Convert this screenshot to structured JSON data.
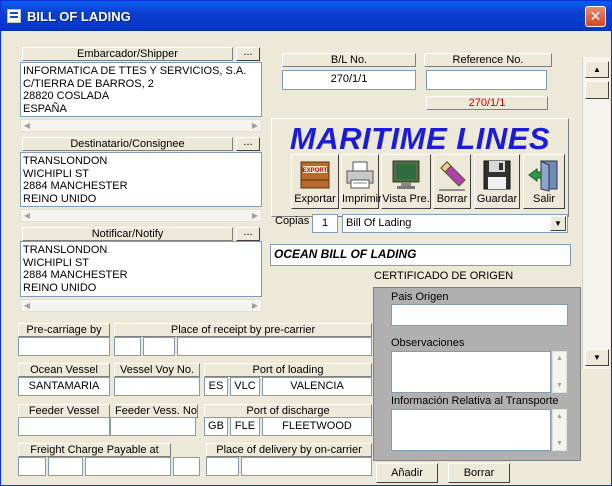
{
  "window": {
    "title": "BILL OF LADING"
  },
  "shipper": {
    "header": "Embarcador/Shipper",
    "lines": "INFORMATICA DE TTES Y SERVICIOS, S.A.\nC/TIERRA DE BARROS, 2\n28820 COSLADA\nESPAÑA"
  },
  "consignee": {
    "header": "Destinatario/Consignee",
    "lines": "TRANSLONDON\nWICHIPLI ST\n2884 MANCHESTER\nREINO UNIDO"
  },
  "notify": {
    "header": "Notificar/Notify",
    "lines": "TRANSLONDON\nWICHIPLI ST\n2884 MANCHESTER\nREINO UNIDO"
  },
  "dots_label": "...",
  "bl": {
    "label": "B/L No.",
    "value": "270/1/1"
  },
  "reference": {
    "label": "Reference No.",
    "value": "",
    "sub_value": "270/1/1",
    "sub_color": "#CC0000"
  },
  "brand": {
    "name": "MARITIME LINES",
    "color": "#1B1BDB"
  },
  "toolbar": {
    "export_tag": "EXPORT",
    "buttons": [
      "Exportar",
      "Imprimir",
      "Vista Pre.",
      "Borrar",
      "Guardar",
      "Salir"
    ]
  },
  "copies": {
    "label": "Copias",
    "value": "1",
    "document": "Bill Of Lading"
  },
  "doc_title": "OCEAN BILL OF LADING",
  "transport": {
    "pre_carriage_label": "Pre-carriage by",
    "place_receipt_label": "Place of receipt by pre-carrier",
    "ocean_vessel_label": "Ocean Vessel",
    "ocean_vessel": "SANTAMARIA",
    "voy_label": "Vessel Voy No.",
    "voy": "",
    "port_loading_label": "Port of loading",
    "port_loading": {
      "country": "ES",
      "code": "VLC",
      "name": "VALENCIA"
    },
    "feeder_vessel_label": "Feeder Vessel",
    "feeder_voy_label": "Feeder Vess. No.",
    "port_discharge_label": "Port of discharge",
    "port_discharge": {
      "country": "GB",
      "code": "FLE",
      "name": "FLEETWOOD"
    },
    "freight_label": "Freight Charge Payable at",
    "delivery_label": "Place of delivery by on-carrier"
  },
  "certificate": {
    "title": "CERTIFICADO DE ORIGEN",
    "pais_label": "Pais Origen",
    "obs_label": "Observaciones",
    "info_label": "Información Relativa al Transporte",
    "add_button": "Añadir",
    "delete_button": "Borrar"
  },
  "icons": [
    "window-icon",
    "close-icon",
    "export-icon",
    "printer-icon",
    "monitor-icon",
    "eraser-icon",
    "floppy-disk-icon",
    "exit-door-icon"
  ],
  "colors": {
    "titlebar": "#0A3FD2",
    "panel": "#ECE9D8",
    "cert_panel": "#B0B0B0"
  }
}
